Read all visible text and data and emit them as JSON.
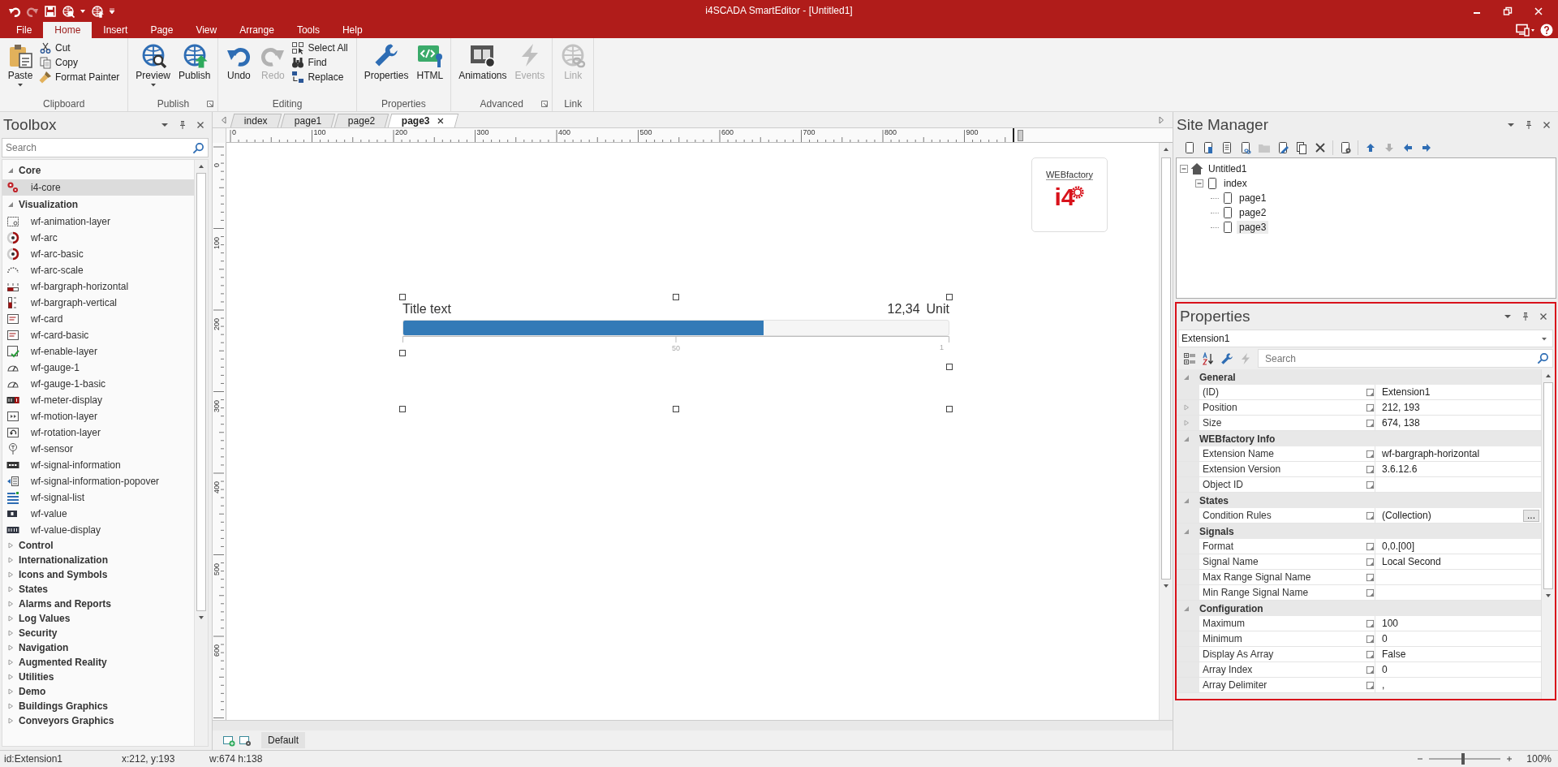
{
  "title_bar": {
    "title": "i4SCADA SmartEditor - [Untitled1]"
  },
  "menu_tabs": [
    {
      "label": "File",
      "selected": false
    },
    {
      "label": "Home",
      "selected": true
    },
    {
      "label": "Insert",
      "selected": false
    },
    {
      "label": "Page",
      "selected": false
    },
    {
      "label": "View",
      "selected": false
    },
    {
      "label": "Arrange",
      "selected": false
    },
    {
      "label": "Tools",
      "selected": false
    },
    {
      "label": "Help",
      "selected": false
    }
  ],
  "ribbon": {
    "groups": [
      {
        "label": "Clipboard",
        "items": [
          {
            "label": "Paste",
            "kind": "large",
            "dropdown": true,
            "disabled": false
          },
          {
            "label": "Cut",
            "kind": "small",
            "disabled": false
          },
          {
            "label": "Copy",
            "kind": "small",
            "disabled": false
          },
          {
            "label": "Format Painter",
            "kind": "small",
            "disabled": false
          }
        ]
      },
      {
        "label": "Publish",
        "launcher": true,
        "items": [
          {
            "label": "Preview",
            "kind": "large",
            "dropdown": true,
            "disabled": false
          },
          {
            "label": "Publish",
            "kind": "large",
            "disabled": false
          }
        ]
      },
      {
        "label": "Editing",
        "items": [
          {
            "label": "Undo",
            "kind": "large",
            "disabled": false
          },
          {
            "label": "Redo",
            "kind": "large",
            "disabled": true
          },
          {
            "label": "Select All",
            "kind": "small",
            "disabled": false
          },
          {
            "label": "Find",
            "kind": "small",
            "disabled": false
          },
          {
            "label": "Replace",
            "kind": "small",
            "disabled": false
          }
        ]
      },
      {
        "label": "Properties",
        "items": [
          {
            "label": "Properties",
            "kind": "large",
            "disabled": false
          },
          {
            "label": "HTML",
            "kind": "large",
            "disabled": false
          }
        ]
      },
      {
        "label": "Advanced",
        "launcher": true,
        "items": [
          {
            "label": "Animations",
            "kind": "large",
            "disabled": false
          },
          {
            "label": "Events",
            "kind": "large",
            "disabled": true
          }
        ]
      },
      {
        "label": "Link",
        "items": [
          {
            "label": "Link",
            "kind": "large",
            "disabled": true
          }
        ]
      }
    ]
  },
  "toolbox": {
    "title": "Toolbox",
    "search": {
      "placeholder": "Search"
    },
    "categories": [
      {
        "label": "Core",
        "expanded": true,
        "items": [
          {
            "label": "i4-core",
            "selected": true
          }
        ]
      },
      {
        "label": "Visualization",
        "expanded": true,
        "items": [
          {
            "label": "wf-animation-layer",
            "selected": false
          },
          {
            "label": "wf-arc",
            "selected": false
          },
          {
            "label": "wf-arc-basic",
            "selected": false
          },
          {
            "label": "wf-arc-scale",
            "selected": false
          },
          {
            "label": "wf-bargraph-horizontal",
            "selected": false
          },
          {
            "label": "wf-bargraph-vertical",
            "selected": false
          },
          {
            "label": "wf-card",
            "selected": false
          },
          {
            "label": "wf-card-basic",
            "selected": false
          },
          {
            "label": "wf-enable-layer",
            "selected": false
          },
          {
            "label": "wf-gauge-1",
            "selected": false
          },
          {
            "label": "wf-gauge-1-basic",
            "selected": false
          },
          {
            "label": "wf-meter-display",
            "selected": false
          },
          {
            "label": "wf-motion-layer",
            "selected": false
          },
          {
            "label": "wf-rotation-layer",
            "selected": false
          },
          {
            "label": "wf-sensor",
            "selected": false
          },
          {
            "label": "wf-signal-information",
            "selected": false
          },
          {
            "label": "wf-signal-information-popover",
            "selected": false
          },
          {
            "label": "wf-signal-list",
            "selected": false
          },
          {
            "label": "wf-value",
            "selected": false
          },
          {
            "label": "wf-value-display",
            "selected": false
          }
        ]
      },
      {
        "label": "Control",
        "expanded": false
      },
      {
        "label": "Internationalization",
        "expanded": false
      },
      {
        "label": "Icons and Symbols",
        "expanded": false
      },
      {
        "label": "States",
        "expanded": false
      },
      {
        "label": "Alarms and Reports",
        "expanded": false
      },
      {
        "label": "Log Values",
        "expanded": false
      },
      {
        "label": "Security",
        "expanded": false
      },
      {
        "label": "Navigation",
        "expanded": false
      },
      {
        "label": "Augmented Reality",
        "expanded": false
      },
      {
        "label": "Utilities",
        "expanded": false
      },
      {
        "label": "Demo",
        "expanded": false
      },
      {
        "label": "Buildings Graphics",
        "expanded": false
      },
      {
        "label": "Conveyors Graphics",
        "expanded": false
      }
    ]
  },
  "canvas": {
    "tabs": [
      {
        "label": "index",
        "selected": false
      },
      {
        "label": "page1",
        "selected": false
      },
      {
        "label": "page2",
        "selected": false
      },
      {
        "label": "page3",
        "selected": true
      }
    ],
    "ruler": {
      "h": [
        "0",
        "100",
        "200",
        "300",
        "400",
        "500",
        "600",
        "700",
        "800",
        "900"
      ],
      "v": [
        "0",
        "100",
        "200",
        "300",
        "400",
        "500",
        "600"
      ]
    },
    "logo": {
      "brand": "WEBfactory",
      "mark": "i4"
    },
    "bargraph": {
      "title": "Title text",
      "value": "12,34",
      "unit": "Unit",
      "level": 0.66,
      "tick_labels": [
        "50",
        "1"
      ]
    },
    "layer_tab": "Default"
  },
  "site_manager": {
    "title": "Site Manager",
    "toolbar": [
      {
        "disabled": false
      },
      {
        "disabled": false
      },
      {
        "disabled": false
      },
      {
        "disabled": false
      },
      {
        "disabled": true
      },
      {
        "disabled": false
      },
      {
        "disabled": false
      },
      {
        "disabled": false
      },
      {
        "disabled": false
      },
      {
        "disabled": false
      },
      {
        "disabled": true
      },
      {
        "disabled": false
      },
      {
        "disabled": false
      }
    ],
    "tree": [
      {
        "label": "Untitled1",
        "kind": "site",
        "expanded": true,
        "selected": false,
        "children": [
          {
            "label": "index",
            "kind": "page",
            "expanded": true,
            "selected": false,
            "children": [
              {
                "label": "page1",
                "kind": "page",
                "selected": false
              },
              {
                "label": "page2",
                "kind": "page",
                "selected": false
              },
              {
                "label": "page3",
                "kind": "page",
                "selected": true
              }
            ]
          }
        ]
      }
    ]
  },
  "properties": {
    "title": "Properties",
    "object": "Extension1",
    "search": {
      "placeholder": "Search"
    },
    "categories": [
      {
        "label": "General",
        "expanded": true,
        "rows": [
          {
            "name": "(ID)",
            "value": "Extension1"
          },
          {
            "name": "Position",
            "value": "212, 193",
            "expandable": true
          },
          {
            "name": "Size",
            "value": "674, 138",
            "expandable": true
          }
        ]
      },
      {
        "label": "WEBfactory Info",
        "expanded": true,
        "rows": [
          {
            "name": "Extension Name",
            "value": "wf-bargraph-horizontal"
          },
          {
            "name": "Extension Version",
            "value": "3.6.12.6"
          },
          {
            "name": "Object ID"
          }
        ]
      },
      {
        "label": "States",
        "expanded": true,
        "rows": [
          {
            "name": "Condition Rules",
            "value": "(Collection)",
            "button": "..."
          }
        ]
      },
      {
        "label": "Signals",
        "expanded": true,
        "rows": [
          {
            "name": "Format",
            "value": "0,0.[00]"
          },
          {
            "name": "Signal Name",
            "value": "Local Second"
          },
          {
            "name": "Max Range Signal Name"
          },
          {
            "name": "Min Range Signal Name"
          }
        ]
      },
      {
        "label": "Configuration",
        "expanded": true,
        "rows": [
          {
            "name": "Maximum",
            "value": "100"
          },
          {
            "name": "Minimum",
            "value": "0"
          },
          {
            "name": "Display As Array",
            "value": "False"
          },
          {
            "name": "Array Index",
            "value": "0"
          },
          {
            "name": "Array Delimiter",
            "value": ","
          }
        ]
      }
    ]
  },
  "status_bar": {
    "id": "id:Extension1",
    "position": "x:212, y:193",
    "size": "w:674 h:138",
    "zoom": {
      "level": 0.47,
      "reading": "100%"
    }
  }
}
